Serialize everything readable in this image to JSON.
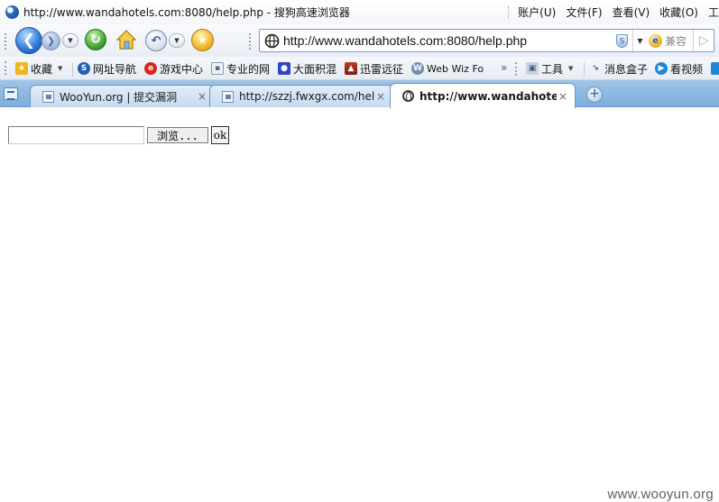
{
  "window": {
    "title": "http://www.wandahotels.com:8080/help.php - 搜狗高速浏览器"
  },
  "menu": [
    {
      "label": "账户(U)",
      "name": "menu-account"
    },
    {
      "label": "文件(F)",
      "name": "menu-file"
    },
    {
      "label": "查看(V)",
      "name": "menu-view"
    },
    {
      "label": "收藏(O)",
      "name": "menu-favorites"
    },
    {
      "label": "工",
      "name": "menu-tools"
    }
  ],
  "address_bar": {
    "url": "http://www.wandahotels.com:8080/help.php",
    "compat_label": "兼容"
  },
  "bookmarks": {
    "favorites_label": "收藏",
    "items": [
      {
        "label": "网址导航",
        "icon": "sogou-nav-icon"
      },
      {
        "label": "游戏中心",
        "icon": "game-center-icon"
      },
      {
        "label": "专业的网",
        "icon": "page-icon"
      },
      {
        "label": "大面积混",
        "icon": "baidu-paw-icon"
      },
      {
        "label": "迅雷远征",
        "icon": "xunlei-game-icon"
      },
      {
        "label": "Web Wiz Fo",
        "icon": "webwiz-icon"
      }
    ],
    "more": "»",
    "tools_label": "工具",
    "right_items": [
      {
        "label": "消息盒子",
        "icon": "message-box-icon"
      },
      {
        "label": "看视频",
        "icon": "video-icon"
      }
    ]
  },
  "tabs": [
    {
      "label": "WooYun.org | 提交漏洞",
      "active": false
    },
    {
      "label": "http://szzj.fwxgx.com/help...",
      "active": false
    },
    {
      "label": "http://www.wandahotel...",
      "active": true
    }
  ],
  "tab_close_glyph": "×",
  "page": {
    "file_input_value": "",
    "browse_label": "浏览...",
    "submit_label": "ok"
  },
  "watermark": "www.wooyun.org",
  "colors": {
    "tabbar": "#7eaede",
    "toolbar": "#e9eef5",
    "accent_blue": "#2d76d6"
  }
}
